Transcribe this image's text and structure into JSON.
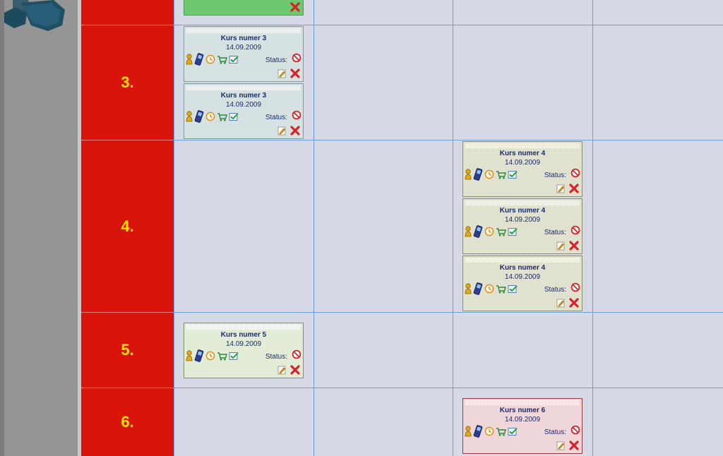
{
  "row_headers": [
    {
      "label": "3."
    },
    {
      "label": "4."
    },
    {
      "label": "5."
    },
    {
      "label": "6."
    }
  ],
  "colors": {
    "row_header_bg": "#d9140b",
    "row_header_text": "#ffe400",
    "grid_bg": "#d5dae6",
    "grid_lines": "#6e9ee2"
  },
  "cards": [
    {
      "title": "Kurs numer 3",
      "date": "14.09.2009",
      "status_label": "Status:"
    },
    {
      "title": "Kurs numer 3",
      "date": "14.09.2009",
      "status_label": "Status:"
    },
    {
      "title": "Kurs numer 4",
      "date": "14.09.2009",
      "status_label": "Status:"
    },
    {
      "title": "Kurs numer 4",
      "date": "14.09.2009",
      "status_label": "Status:"
    },
    {
      "title": "Kurs numer 4",
      "date": "14.09.2009",
      "status_label": "Status:"
    },
    {
      "title": "Kurs numer 5",
      "date": "14.09.2009",
      "status_label": "Status:"
    },
    {
      "title": "Kurs numer 6",
      "date": "14.09.2009",
      "status_label": "Status:"
    }
  ],
  "card_icons": [
    "person-icon",
    "mobile-phone-icon",
    "clock-icon",
    "shopping-cart-icon",
    "checklist-icon",
    "status-blocked-icon",
    "edit-icon",
    "delete-icon"
  ]
}
